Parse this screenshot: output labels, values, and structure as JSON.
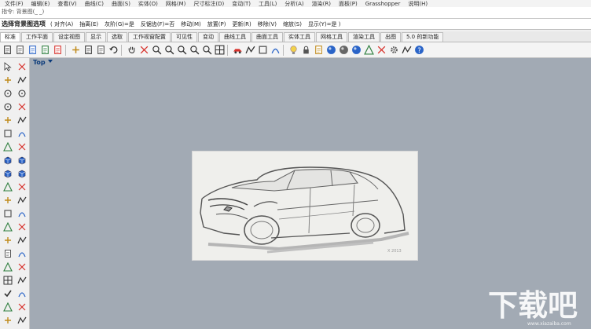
{
  "menu": {
    "items": [
      "文件(F)",
      "编辑(E)",
      "查看(V)",
      "曲线(C)",
      "曲面(S)",
      "实体(O)",
      "网格(M)",
      "尺寸标注(D)",
      "变动(T)",
      "工具(L)",
      "分析(A)",
      "渲染(R)",
      "面板(P)",
      "Grasshopper",
      "说明(H)"
    ]
  },
  "command_history": {
    "text": "指令: 背景图(_ _)"
  },
  "command_prompt": {
    "lead": "选择背景图选项",
    "options": [
      "( 对齐(A)",
      "抽离(E)",
      "灰阶(G)=是",
      "反锯齿(F)=否",
      "移动(M)",
      "放置(P)",
      "更新(R)",
      "移除(V)",
      "缩放(S)",
      "显示(Y)=是 )"
    ]
  },
  "tabs": {
    "items": [
      "标准",
      "工作平面",
      "设定视图",
      "显示",
      "选取",
      "工作视窗配置",
      "可见性",
      "变动",
      "曲线工具",
      "曲面工具",
      "实体工具",
      "网格工具",
      "渲染工具",
      "出图",
      "5.0 的新功能"
    ],
    "active_index": 0
  },
  "toolbar": {
    "icons": [
      "new-file-icon",
      "open-file-icon",
      "save-icon",
      "print-icon",
      "import-icon",
      "cut-icon",
      "copy-icon",
      "paste-icon",
      "undo-icon",
      "pan-hand-icon",
      "rotate-view-icon",
      "zoom-icon",
      "zoom-extents-icon",
      "zoom-window-icon",
      "zoom-selected-icon",
      "zoom-dynamic-icon",
      "four-view-icon",
      "car-icon",
      "swap-view-icon",
      "cplane-icon",
      "set-view-icon",
      "light-bulb-icon",
      "lock-icon",
      "layer-icon",
      "render-sphere-icon",
      "shaded-sphere-icon",
      "material-sphere-icon",
      "render-icon",
      "environment-icon",
      "settings-gear-icon",
      "object-snap-icon",
      "help-icon"
    ]
  },
  "sidebar": {
    "icons": [
      "select-arrow-icon",
      "select-points-icon",
      "polyline-icon",
      "curve-points-icon",
      "circle-icon",
      "ellipse-icon",
      "arc-icon",
      "rectangle-icon",
      "polygon-icon",
      "fillet-curve-icon",
      "curve-tool-icon",
      "offset-curve-icon",
      "extrude-icon",
      "surface-icon",
      "box-solid-icon",
      "solid-tool-icon",
      "boolean-icon",
      "cap-icon",
      "transform-icon",
      "move-icon",
      "mirror-icon",
      "array-icon",
      "join-icon",
      "explode-icon",
      "trim-icon",
      "split-icon",
      "rebuild-icon",
      "dimension-icon",
      "text-icon",
      "hatch-icon",
      "mesh-icon",
      "analyze-icon",
      "grid-dots-icon",
      "points-icon",
      "check-icon",
      "render-tool-icon",
      "group-icon",
      "history-icon",
      "edit-points-icon",
      "more-icon"
    ]
  },
  "viewport": {
    "title": "Top",
    "background_color": "#a2aab4"
  },
  "watermark": {
    "text": "下载吧",
    "site": "www.xiazaiba.com"
  },
  "sketch": {
    "signature": "X 2013"
  },
  "colors": {
    "accent_blue": "#0a3a7a",
    "red_icon": "#d7302a",
    "blue_icon": "#2a64c8"
  }
}
